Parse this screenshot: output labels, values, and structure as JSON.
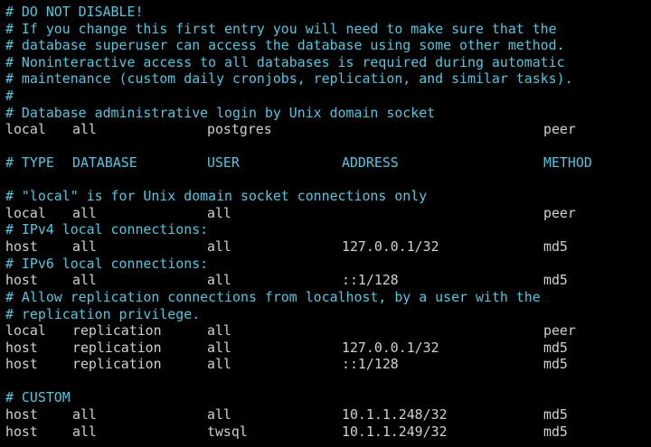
{
  "colors": {
    "background": "#000000",
    "comment": "#54c7e0",
    "text": "#d0d0d0"
  },
  "comments": {
    "disable_warning": "# DO NOT DISABLE!",
    "first_entry_1": "# If you change this first entry you will need to make sure that the",
    "first_entry_2": "# database superuser can access the database using some other method.",
    "noninteractive_1": "# Noninteractive access to all databases is required during automatic",
    "noninteractive_2": "# maintenance (custom daily cronjobs, replication, and similar tasks).",
    "empty": "#",
    "admin_login": "# Database administrative login by Unix domain socket",
    "local_unix": "# \"local\" is for Unix domain socket connections only",
    "ipv4": "# IPv4 local connections:",
    "ipv6": "# IPv6 local connections:",
    "replication_1": "# Allow replication connections from localhost, by a user with the",
    "replication_2": "# replication privilege.",
    "custom": "# CUSTOM"
  },
  "header": {
    "type": "# TYPE",
    "database": "DATABASE",
    "user": "USER",
    "address": "ADDRESS",
    "method": "METHOD"
  },
  "entries": {
    "admin_local": {
      "type": "local",
      "database": "all",
      "user": "postgres",
      "address": "",
      "method": "peer"
    },
    "local_all": {
      "type": "local",
      "database": "all",
      "user": "all",
      "address": "",
      "method": "peer"
    },
    "host_ipv4": {
      "type": "host",
      "database": "all",
      "user": "all",
      "address": "127.0.0.1/32",
      "method": "md5"
    },
    "host_ipv6": {
      "type": "host",
      "database": "all",
      "user": "all",
      "address": "::1/128",
      "method": "md5"
    },
    "repl_local": {
      "type": "local",
      "database": "replication",
      "user": "all",
      "address": "",
      "method": "peer"
    },
    "repl_ipv4": {
      "type": "host",
      "database": "replication",
      "user": "all",
      "address": "127.0.0.1/32",
      "method": "md5"
    },
    "repl_ipv6": {
      "type": "host",
      "database": "replication",
      "user": "all",
      "address": "::1/128",
      "method": "md5"
    },
    "custom_1": {
      "type": "host",
      "database": "all",
      "user": "all",
      "address": "10.1.1.248/32",
      "method": "md5"
    },
    "custom_2": {
      "type": "host",
      "database": "all",
      "user": "twsql",
      "address": "10.1.1.249/32",
      "method": "md5"
    }
  }
}
